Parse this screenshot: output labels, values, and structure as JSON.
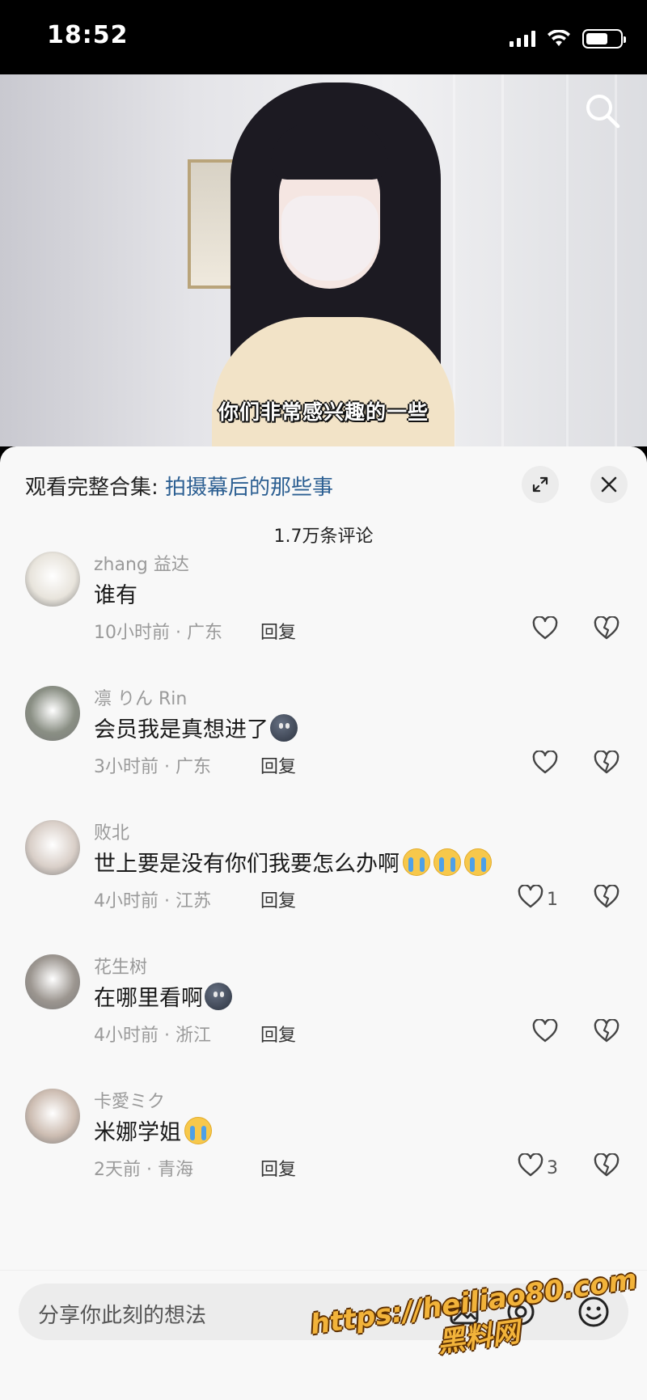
{
  "status_bar": {
    "time": "18:52",
    "battery_level": 0.65
  },
  "video": {
    "subtitle": "你们非常感兴趣的一些"
  },
  "sheet": {
    "collection_prefix": "观看完整合集: ",
    "collection_title": "拍摄幕后的那些事",
    "comment_count": "1.7万条评论"
  },
  "comments": [
    {
      "user": "zhang 益达",
      "text": "谁有",
      "emoji": [],
      "meta": "10小时前 · 广东",
      "reply": "回复",
      "likes": "",
      "avatar_color": "#e8e4dc"
    },
    {
      "user": "凛 りん Rin",
      "text": "会员我是真想进了",
      "emoji": [
        "dark"
      ],
      "meta": "3小时前 · 广东",
      "reply": "回复",
      "likes": "",
      "avatar_color": "#8a8f84"
    },
    {
      "user": "败北",
      "text": "世上要是没有你们我要怎么办啊",
      "emoji": [
        "cry",
        "cry",
        "cry"
      ],
      "meta": "4小时前 · 江苏",
      "reply": "回复",
      "likes": "1",
      "avatar_color": "#d9cfc8"
    },
    {
      "user": "花生树",
      "text": "在哪里看啊",
      "emoji": [
        "dark"
      ],
      "meta": "4小时前 · 浙江",
      "reply": "回复",
      "likes": "",
      "avatar_color": "#9c9690"
    },
    {
      "user": "卡愛ミク",
      "text": "米娜学姐",
      "emoji": [
        "cry"
      ],
      "meta": "2天前 · 青海",
      "reply": "回复",
      "likes": "3",
      "avatar_color": "#cdbdb2"
    }
  ],
  "input": {
    "placeholder": "分享你此刻的想法"
  },
  "watermark": {
    "line1": "https://heiliao80.com",
    "line2": "黑料网"
  },
  "icons": {
    "search": "search-icon",
    "expand": "expand-icon",
    "close": "close-icon",
    "like": "heart-icon",
    "dislike": "broken-heart-icon",
    "image": "image-icon",
    "at": "at-icon",
    "emoji": "smile-icon"
  }
}
